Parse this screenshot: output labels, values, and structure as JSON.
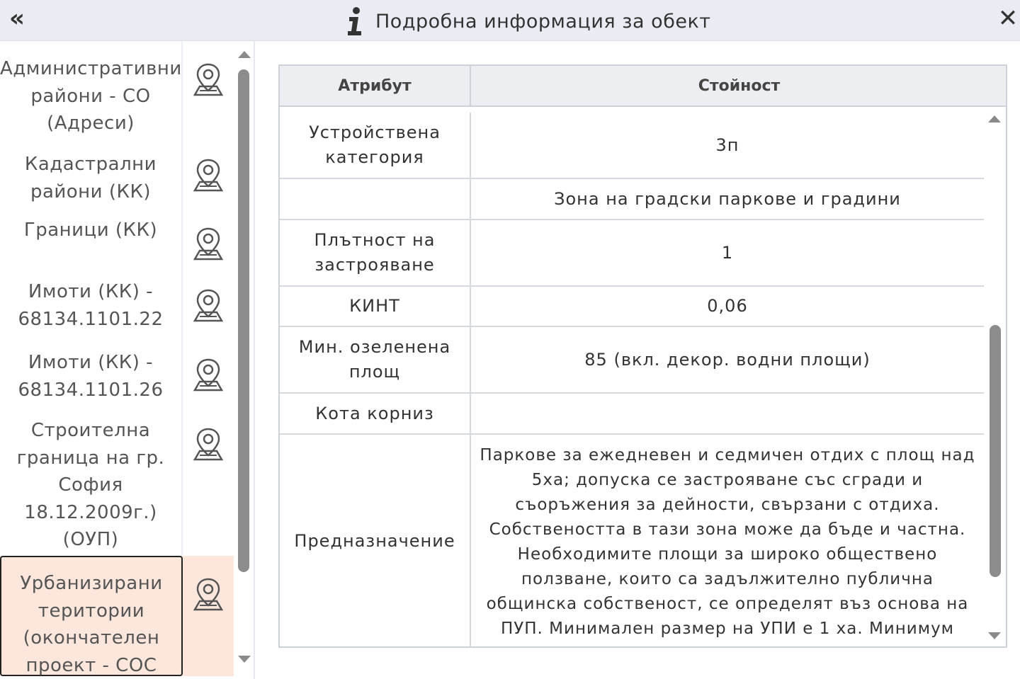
{
  "header": {
    "collapse_label": "«",
    "title": "Подробна информация за обект",
    "close_label": "✕"
  },
  "sidebar": {
    "items": [
      {
        "label": "Административни райони - СО (Адреси)",
        "icon": "map-pin-icon"
      },
      {
        "label": "Кадастрални райони (КК)",
        "icon": "map-pin-icon"
      },
      {
        "label": "Граници (КК)",
        "icon": "map-pin-icon"
      },
      {
        "label": "Имоти (КК) - 68134.1101.22",
        "icon": "map-pin-icon"
      },
      {
        "label": "Имоти (КК) - 68134.1101.26",
        "icon": "map-pin-icon"
      },
      {
        "label": "Строителна граница на гр. София 18.12.2009г.) (ОУП)",
        "icon": "map-pin-icon"
      },
      {
        "label": "Урбанизирани територии (окончателен проект - СОС",
        "icon": "map-pin-icon",
        "selected": true
      }
    ]
  },
  "table": {
    "headers": {
      "attribute": "Атрибут",
      "value": "Стойност"
    },
    "rows": [
      {
        "attribute": "Устройствена категория",
        "value": "3п"
      },
      {
        "attribute": "",
        "value": "Зона на градски паркове и градини"
      },
      {
        "attribute": "Плътност на застрояване",
        "value": "1"
      },
      {
        "attribute": "КИНТ",
        "value": "0,06"
      },
      {
        "attribute": "Мин. озеленена площ",
        "value": "85 (вкл. декор. водни площи)"
      },
      {
        "attribute": "Кота корниз",
        "value": ""
      },
      {
        "attribute": "Предназначение",
        "value": "Паркове за ежедневен и седмичен отдих с площ над 5ха; допуска се застрояване със сгради и съоръжения за дейности, свързани с отдиха. Собствеността в тази зона може да бъде и частна. Необходимите площи за широко обществено ползване, които са задължително публична общинска собственост, се определят въз основа на ПУП. Минимален размер на УПИ е 1 ха. Минимум"
      }
    ]
  },
  "colors": {
    "header_bg": "#e9edf3",
    "selected_bg": "#fde7dc",
    "table_header_bg": "#eceef1"
  }
}
